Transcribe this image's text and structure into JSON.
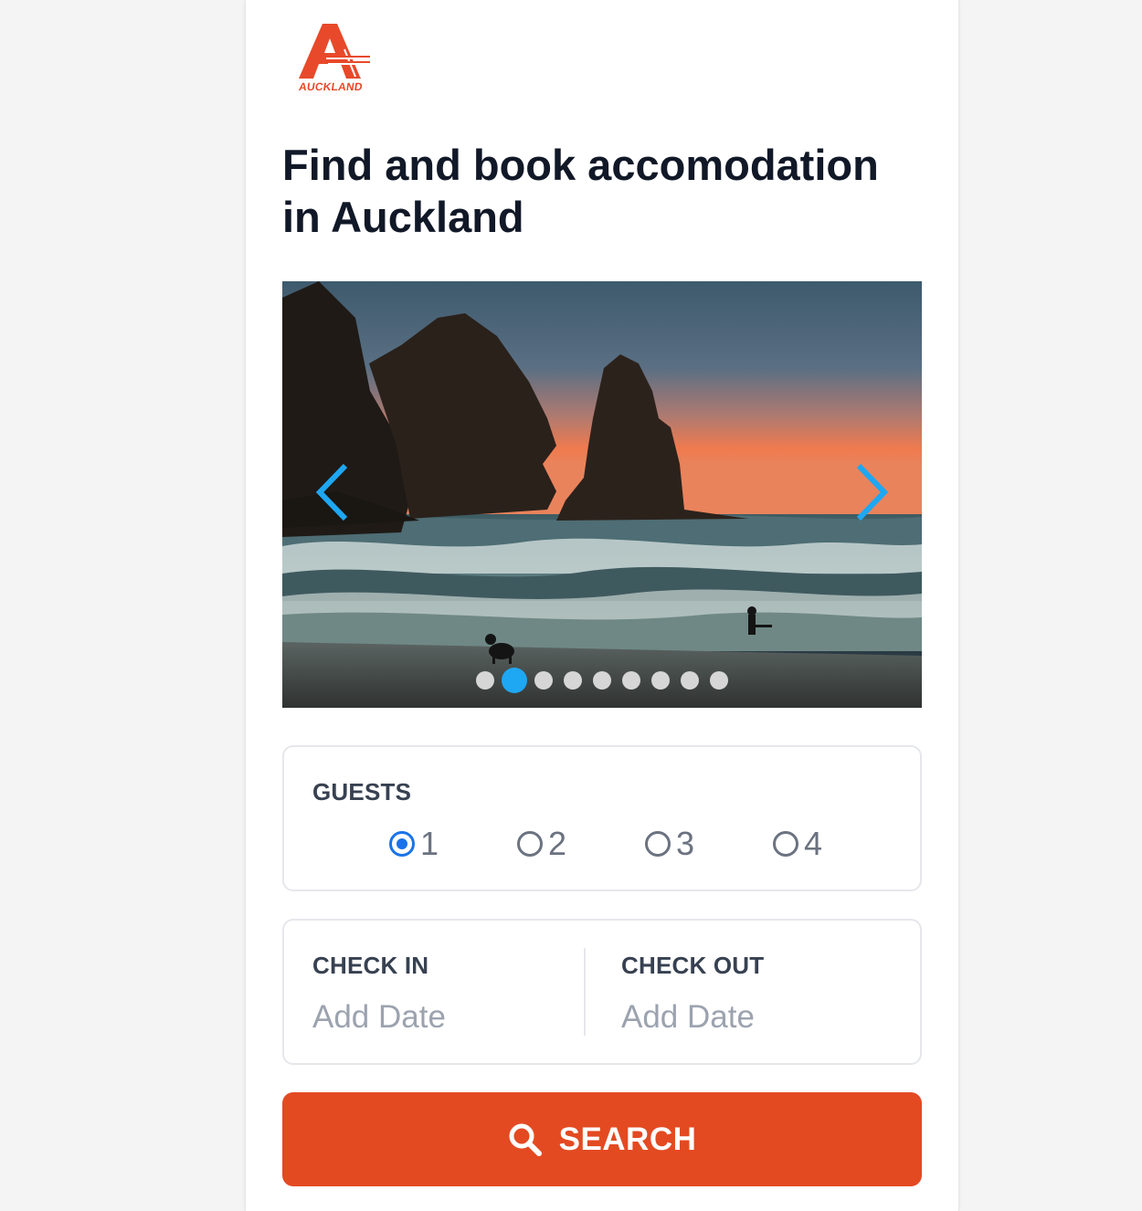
{
  "logo": {
    "text": "AUCKLAND",
    "color": "#e8492a"
  },
  "headline": "Find and book accomodation in Auckland",
  "carousel": {
    "prev_icon": "chevron-left-icon",
    "next_icon": "chevron-right-icon",
    "slide_count": 9,
    "active_index": 1,
    "accent": "#1ea7f2"
  },
  "guests": {
    "label": "GUESTS",
    "options": [
      "1",
      "2",
      "3",
      "4"
    ],
    "selected": "1"
  },
  "dates": {
    "check_in_label": "CHECK IN",
    "check_in_value": "Add Date",
    "check_out_label": "CHECK OUT",
    "check_out_value": "Add Date"
  },
  "search": {
    "label": "SEARCH",
    "icon": "search-icon",
    "color": "#e34a22"
  }
}
